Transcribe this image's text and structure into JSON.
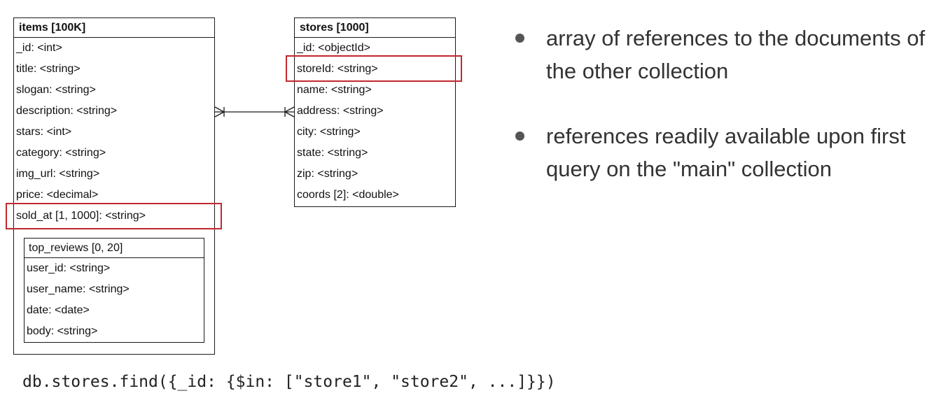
{
  "items_table": {
    "title": "items [100K]",
    "fields": [
      "_id: <int>",
      "title: <string>",
      "slogan: <string>",
      "description: <string>",
      "stars: <int>",
      "category: <string>",
      "img_url: <string>",
      "price: <decimal>",
      "sold_at [1, 1000]: <string>"
    ],
    "subtable": {
      "title": "top_reviews [0, 20]",
      "fields": [
        "user_id: <string>",
        "user_name: <string>",
        "date: <date>",
        "body: <string>"
      ]
    }
  },
  "stores_table": {
    "title": "stores [1000]",
    "fields": [
      "_id: <objectId>",
      "storeId: <string>",
      "name: <string>",
      "address: <string>",
      "city: <string>",
      "state: <string>",
      "zip: <string>",
      "coords [2]: <double>"
    ]
  },
  "relationship": {
    "from": "items.description",
    "to": "stores.address",
    "notation": "many-to-many (crow's foot)"
  },
  "highlights": {
    "color": "#c0282e",
    "fields": [
      "sold_at [1, 1000]: <string>",
      "storeId: <string>"
    ]
  },
  "bullets": [
    "array of references to the documents of the other collection",
    "references readily available upon first query on the \"main\" collection"
  ],
  "code": "db.stores.find({_id: {$in: [\"store1\", \"store2\", ...]}})"
}
